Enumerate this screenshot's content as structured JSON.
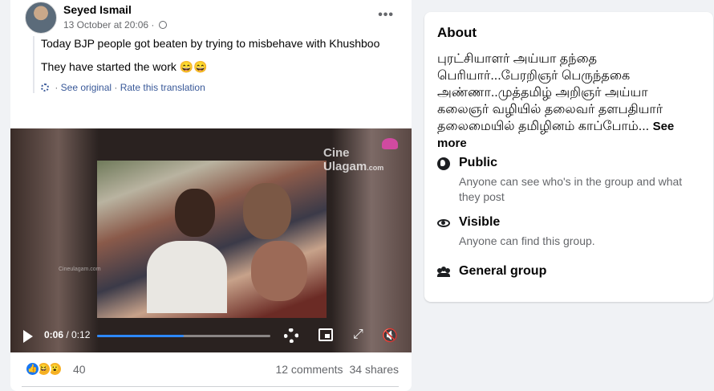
{
  "post": {
    "author": "Seyed Ismail",
    "timestamp": "13 October at 20:06 ·",
    "menu_icon": "more-dots-icon",
    "text_line1": "Today BJP people got beaten by trying to misbehave with Khushboo",
    "text_line2": "They have started the work 😄😄",
    "see_original": "See original",
    "separator": " · ",
    "rate_translation": "Rate this translation",
    "video": {
      "watermark": "Cine Ulagam",
      "watermark_sub": ".com",
      "watermark_small": "Cineulagam.com",
      "current_time": "0:06",
      "total_time": " / 0:12",
      "progress": 0.5
    },
    "reactions": {
      "like_glyph": "👍",
      "haha_glyph": "😆",
      "wow_glyph": "😮",
      "count": "40"
    },
    "comments": "12 comments",
    "shares": "34 shares"
  },
  "about": {
    "heading": "About",
    "description": "புரட்சியாளர் அய்யா தந்தை பெரியார்...பேரறிஞர் பெருந்தகை அண்ணா..முத்தமிழ் அறிஞர் அய்யா கலைஞர் வழியில் தலைவர் தளபதியார் தலைமையில் தமிழினம் காப்போம்...",
    "see_more": "See more",
    "items": [
      {
        "title": "Public",
        "sub": "Anyone can see who's in the group and what they post",
        "icon": "globe-icon"
      },
      {
        "title": "Visible",
        "sub": "Anyone can find this group.",
        "icon": "eye-icon"
      },
      {
        "title": "General group",
        "sub": "",
        "icon": "people-icon"
      }
    ]
  },
  "colors": {
    "accent": "#1877f2",
    "link": "#385898",
    "progress": "#2d88ff",
    "page_bg": "#f0f2f5"
  }
}
